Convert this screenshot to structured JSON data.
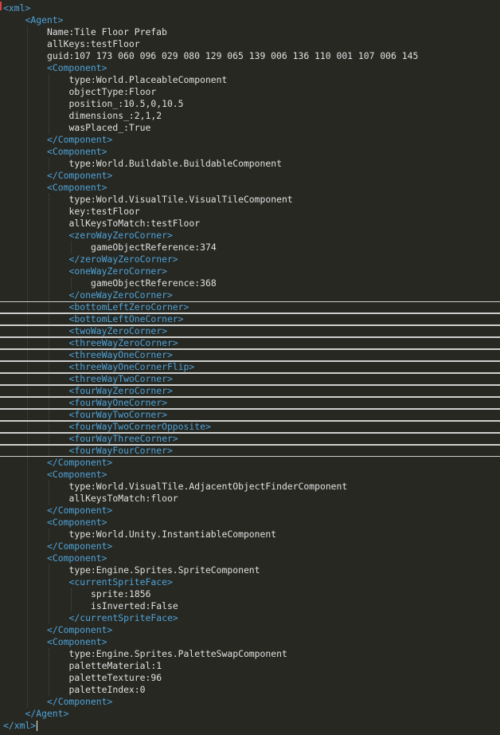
{
  "editor": {
    "colors": {
      "background": "#272822",
      "tag": "#4fa3d9",
      "text": "#e0e0e0",
      "box_border": "#cfcfcf"
    },
    "lines": [
      {
        "indent": 0,
        "kind": "tag",
        "text": "<xml>"
      },
      {
        "indent": 1,
        "kind": "tag",
        "text": "<Agent>"
      },
      {
        "indent": 2,
        "kind": "text",
        "text": "Name:Tile Floor Prefab"
      },
      {
        "indent": 2,
        "kind": "text",
        "text": "allKeys:testFloor"
      },
      {
        "indent": 2,
        "kind": "text",
        "text": "guid:107 173 060 096 029 080 129 065 139 006 136 110 001 107 006 145"
      },
      {
        "indent": 2,
        "kind": "tag",
        "text": "<Component>"
      },
      {
        "indent": 3,
        "kind": "text",
        "text": "type:World.PlaceableComponent"
      },
      {
        "indent": 3,
        "kind": "text",
        "text": "objectType:Floor"
      },
      {
        "indent": 3,
        "kind": "text",
        "text": "position_:10.5,0,10.5"
      },
      {
        "indent": 3,
        "kind": "text",
        "text": "dimensions_:2,1,2"
      },
      {
        "indent": 3,
        "kind": "text",
        "text": "wasPlaced_:True"
      },
      {
        "indent": 2,
        "kind": "tag",
        "text": "</Component>"
      },
      {
        "indent": 2,
        "kind": "tag",
        "text": "<Component>"
      },
      {
        "indent": 3,
        "kind": "text",
        "text": "type:World.Buildable.BuildableComponent"
      },
      {
        "indent": 2,
        "kind": "tag",
        "text": "</Component>"
      },
      {
        "indent": 2,
        "kind": "tag",
        "text": "<Component>"
      },
      {
        "indent": 3,
        "kind": "text",
        "text": "type:World.VisualTile.VisualTileComponent"
      },
      {
        "indent": 3,
        "kind": "text",
        "text": "key:testFloor"
      },
      {
        "indent": 3,
        "kind": "text",
        "text": "allKeysToMatch:testFloor"
      },
      {
        "indent": 3,
        "kind": "tag",
        "text": "<zeroWayZeroCorner>"
      },
      {
        "indent": 4,
        "kind": "text",
        "text": "gameObjectReference:374"
      },
      {
        "indent": 3,
        "kind": "tag",
        "text": "</zeroWayZeroCorner>"
      },
      {
        "indent": 3,
        "kind": "tag",
        "text": "<oneWayZeroCorner>"
      },
      {
        "indent": 4,
        "kind": "text",
        "text": "gameObjectReference:368"
      },
      {
        "indent": 3,
        "kind": "tag",
        "text": "</oneWayZeroCorner>"
      },
      {
        "indent": 3,
        "kind": "tag",
        "text": "<bottomLeftZeroCorner>",
        "boxed": true
      },
      {
        "indent": 3,
        "kind": "tag",
        "text": "<bottomLeftOneCorner>",
        "boxed": true
      },
      {
        "indent": 3,
        "kind": "tag",
        "text": "<twoWayZeroCorner>",
        "boxed": true
      },
      {
        "indent": 3,
        "kind": "tag",
        "text": "<threeWayZeroCorner>",
        "boxed": true
      },
      {
        "indent": 3,
        "kind": "tag",
        "text": "<threeWayOneCorner>",
        "boxed": true
      },
      {
        "indent": 3,
        "kind": "tag",
        "text": "<threeWayOneCornerFlip>",
        "boxed": true
      },
      {
        "indent": 3,
        "kind": "tag",
        "text": "<threeWayTwoCorner>",
        "boxed": true
      },
      {
        "indent": 3,
        "kind": "tag",
        "text": "<fourWayZeroCorner>",
        "boxed": true
      },
      {
        "indent": 3,
        "kind": "tag",
        "text": "<fourWayOneCorner>",
        "boxed": true
      },
      {
        "indent": 3,
        "kind": "tag",
        "text": "<fourWayTwoCorner>",
        "boxed": true
      },
      {
        "indent": 3,
        "kind": "tag",
        "text": "<fourWayTwoCornerOpposite>",
        "boxed": true
      },
      {
        "indent": 3,
        "kind": "tag",
        "text": "<fourWayThreeCorner>",
        "boxed": true
      },
      {
        "indent": 3,
        "kind": "tag",
        "text": "<fourWayFourCorner>",
        "boxed": true
      },
      {
        "indent": 2,
        "kind": "tag",
        "text": "</Component>"
      },
      {
        "indent": 2,
        "kind": "tag",
        "text": "<Component>"
      },
      {
        "indent": 3,
        "kind": "text",
        "text": "type:World.VisualTile.AdjacentObjectFinderComponent"
      },
      {
        "indent": 3,
        "kind": "text",
        "text": "allKeysToMatch:floor"
      },
      {
        "indent": 2,
        "kind": "tag",
        "text": "</Component>"
      },
      {
        "indent": 2,
        "kind": "tag",
        "text": "<Component>"
      },
      {
        "indent": 3,
        "kind": "text",
        "text": "type:World.Unity.InstantiableComponent"
      },
      {
        "indent": 2,
        "kind": "tag",
        "text": "</Component>"
      },
      {
        "indent": 2,
        "kind": "tag",
        "text": "<Component>"
      },
      {
        "indent": 3,
        "kind": "text",
        "text": "type:Engine.Sprites.SpriteComponent"
      },
      {
        "indent": 3,
        "kind": "tag",
        "text": "<currentSpriteFace>"
      },
      {
        "indent": 4,
        "kind": "text",
        "text": "sprite:1856"
      },
      {
        "indent": 4,
        "kind": "text",
        "text": "isInverted:False"
      },
      {
        "indent": 3,
        "kind": "tag",
        "text": "</currentSpriteFace>"
      },
      {
        "indent": 2,
        "kind": "tag",
        "text": "</Component>"
      },
      {
        "indent": 2,
        "kind": "tag",
        "text": "<Component>"
      },
      {
        "indent": 3,
        "kind": "text",
        "text": "type:Engine.Sprites.PaletteSwapComponent"
      },
      {
        "indent": 3,
        "kind": "text",
        "text": "paletteMaterial:1"
      },
      {
        "indent": 3,
        "kind": "text",
        "text": "paletteTexture:96"
      },
      {
        "indent": 3,
        "kind": "text",
        "text": "paletteIndex:0"
      },
      {
        "indent": 2,
        "kind": "tag",
        "text": "</Component>"
      },
      {
        "indent": 1,
        "kind": "tag",
        "text": "</Agent>"
      },
      {
        "indent": 0,
        "kind": "tag",
        "text": "</xml>",
        "cursor": true
      }
    ]
  }
}
